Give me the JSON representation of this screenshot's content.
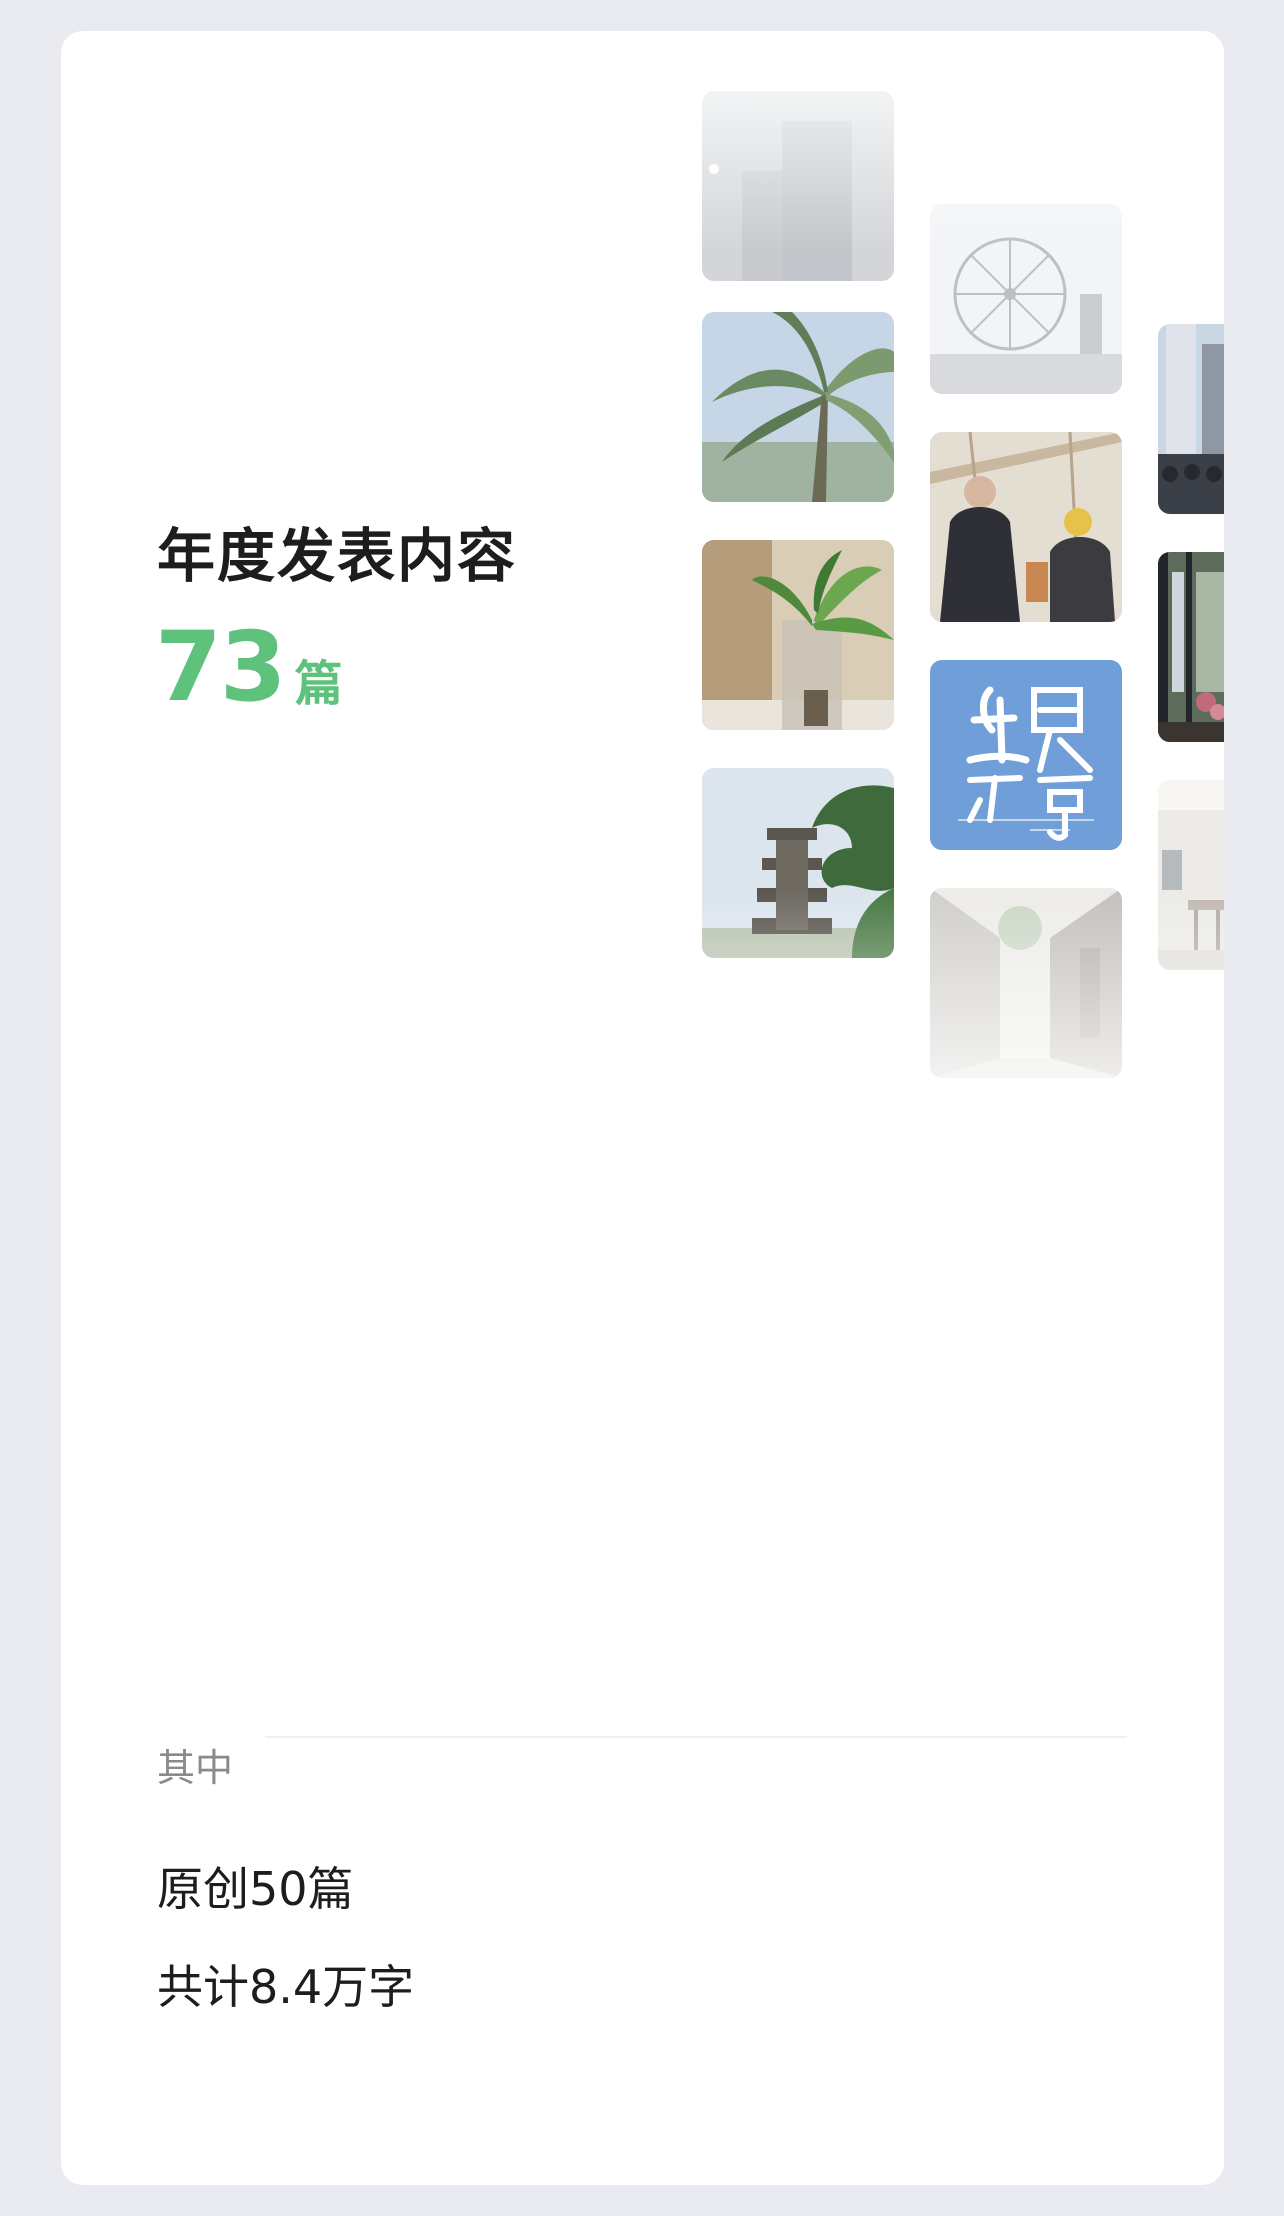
{
  "card": {
    "title": "年度发表内容",
    "count": "73",
    "count_unit": "篇",
    "breakdown_label": "其中",
    "original_articles": "原创50篇",
    "total_words": "共计8.4万字"
  },
  "colors": {
    "accent_green": "#5ec27d",
    "page_background": "#e9ebf0",
    "card_background": "#ffffff",
    "title_text": "#1d1d1d",
    "muted_text": "#8a8a8a"
  },
  "photo_wall": {
    "photos": [
      {
        "name": "photo-building-night"
      },
      {
        "name": "photo-ferris-wheel"
      },
      {
        "name": "photo-palm-tree"
      },
      {
        "name": "photo-station-crowd"
      },
      {
        "name": "photo-children-playground"
      },
      {
        "name": "photo-potted-plant"
      },
      {
        "name": "photo-cafe-window"
      },
      {
        "name": "photo-calligraphy-poster"
      },
      {
        "name": "photo-pagoda-pine"
      },
      {
        "name": "photo-cafe-interior"
      },
      {
        "name": "photo-old-alley"
      }
    ]
  }
}
